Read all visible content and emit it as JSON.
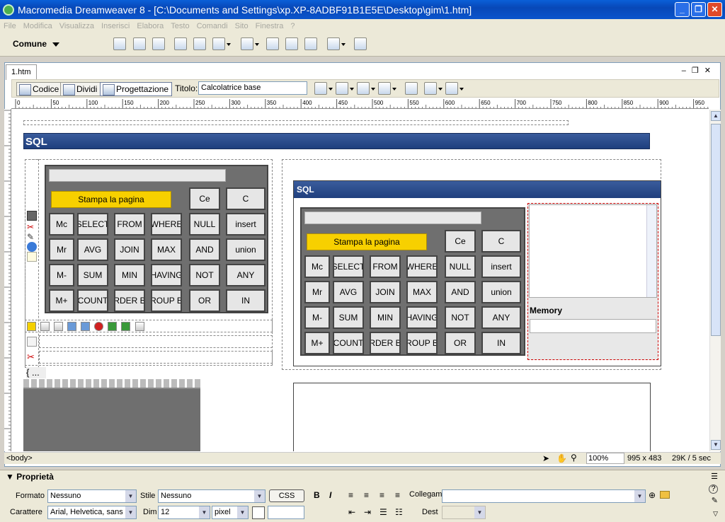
{
  "window": {
    "title": "Macromedia Dreamweaver 8 - [C:\\Documents and Settings\\xp.XP-8ADBF91B1E5E\\Desktop\\gim\\1.htm]"
  },
  "menu": [
    "File",
    "Modifica",
    "Visualizza",
    "Inserisci",
    "Elabora",
    "Testo",
    "Comandi",
    "Sito",
    "Finestra",
    "?"
  ],
  "insert_bar": {
    "category": "Comune"
  },
  "document": {
    "tab": "1.htm",
    "views": {
      "code": "Codice",
      "split": "Dividi",
      "design": "Progettazione"
    },
    "title_label": "Titolo:",
    "title_value": "Calcolatrice base"
  },
  "ruler": {
    "h_ticks": [
      "0",
      "50",
      "100",
      "150",
      "200",
      "250",
      "300",
      "350",
      "400",
      "450",
      "500",
      "550",
      "600",
      "650",
      "700",
      "750",
      "800",
      "850",
      "900",
      "950"
    ]
  },
  "page": {
    "header": "SQL",
    "inner_header": "SQL",
    "memory_label": "Memory",
    "placeholder_text": "{ ..."
  },
  "calculator": {
    "print_label": "Stampa la pagina",
    "top_keys": [
      "Ce",
      "C"
    ],
    "rows": [
      [
        "Mc",
        "SELECT",
        "FROM",
        "WHERE",
        "NULL",
        "insert"
      ],
      [
        "Mr",
        "AVG",
        "JOIN",
        "MAX",
        "AND",
        "union"
      ],
      [
        "M-",
        "SUM",
        "MIN",
        "HAVING",
        "NOT",
        "ANY"
      ],
      [
        "M+",
        "COUNT",
        "RDER B",
        "ROUP B",
        "OR",
        "IN"
      ]
    ]
  },
  "status": {
    "tag": "<body>",
    "zoom": "100%",
    "size": "995 x 483",
    "download": "29K / 5 sec"
  },
  "properties": {
    "title": "Proprietà",
    "format_label": "Formato",
    "format_value": "Nessuno",
    "style_label": "Stile",
    "style_value": "Nessuno",
    "css_button": "CSS",
    "bold": "B",
    "italic": "I",
    "link_label": "Collegam",
    "font_label": "Carattere",
    "font_value": "Arial, Helvetica, sans",
    "size_label": "Dim",
    "size_value": "12",
    "unit_value": "pixel",
    "target_label": "Dest"
  }
}
